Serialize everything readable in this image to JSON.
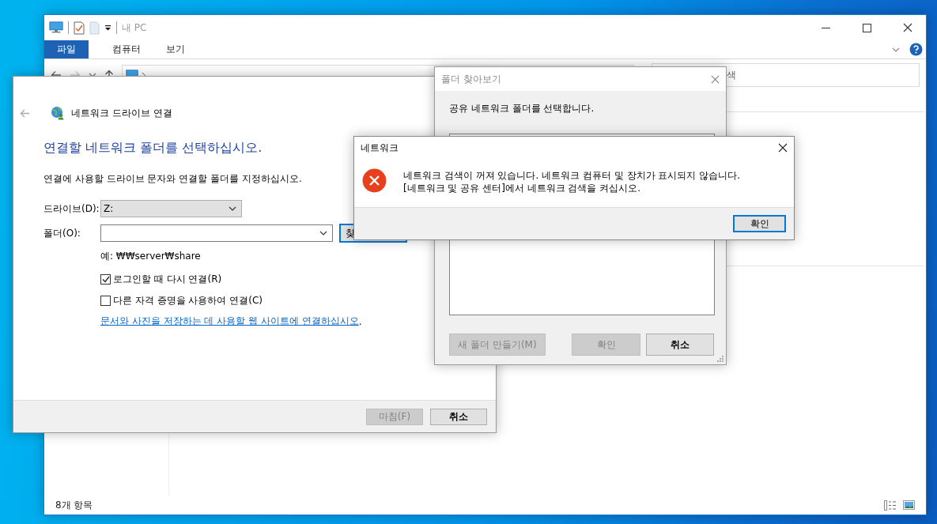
{
  "explorer": {
    "title": "내 PC",
    "ribbon_tabs": [
      {
        "label": "파일",
        "selected": true
      },
      {
        "label": "컴퓨터",
        "selected": false
      },
      {
        "label": "보기",
        "selected": false
      }
    ],
    "search": {
      "placeholder": "색"
    },
    "status_bar": {
      "item_count": "8개 항목"
    }
  },
  "map_drive_wizard": {
    "title": "네트워크 드라이브 연결",
    "heading": "연결할 네트워크 폴더를 선택하십시오.",
    "description": "연결에 사용할 드라이브 문자와 연결할 폴더를 지정하십시오.",
    "drive": {
      "label": "드라이브(D):",
      "value": "Z:"
    },
    "folder": {
      "label": "폴더(O):"
    },
    "browse_button": {
      "label": "찾",
      "focused": true
    },
    "example": "예: ₩₩server₩share",
    "options": [
      {
        "label": "로그인할 때 다시 연결(R)",
        "checked": true
      },
      {
        "label": "다른 자격 증명을 사용하여 연결(C)",
        "checked": false
      }
    ],
    "link": "문서와 사진을 저장하는 데 사용할 웹 사이트에 연결하십시오",
    "link_suffix": ".",
    "buttons": [
      {
        "label": "마침(F)",
        "disabled": true
      },
      {
        "label": "취소",
        "disabled": false
      }
    ]
  },
  "browse_dialog": {
    "title": "폴더 찾아보기",
    "instruction": "공유 네트워크 폴더를 선택합니다.",
    "buttons": [
      {
        "label": "새 폴더 만들기(M)",
        "disabled": true
      },
      {
        "label": "확인",
        "disabled": true
      },
      {
        "label": "취소",
        "disabled": false
      }
    ]
  },
  "error_dialog": {
    "title": "네트워크",
    "message": "네트워크 검색이 꺼져 있습니다. 네트워크 컴퓨터 및 장치가 표시되지 않습니다. [네트워크 및 공유 센터]에서 네트워크 검색을 켜십시오.",
    "buttons": [
      {
        "label": "확인",
        "focused": true
      }
    ]
  }
}
